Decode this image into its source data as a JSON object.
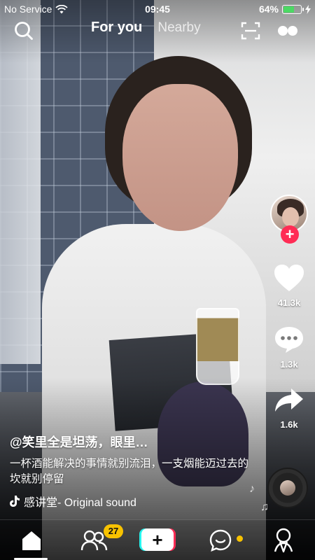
{
  "status_bar": {
    "carrier": "No Service",
    "time": "09:45",
    "battery_percent": "64%",
    "battery_level": 0.64
  },
  "top_nav": {
    "tabs": [
      {
        "label": "For you",
        "active": true
      },
      {
        "label": "Nearby",
        "active": false
      }
    ],
    "icons": [
      "search-icon",
      "scan-icon",
      "more-icon"
    ]
  },
  "side_rail": {
    "like_count": "41.3k",
    "comment_count": "1.3k",
    "share_count": "1.6k",
    "follow_symbol": "+"
  },
  "caption": {
    "username": "@笑里全是坦荡，眼里…",
    "description": "一杯酒能解决的事情就别流泪，一支烟能迈过去的坎就别停留",
    "music": "感讲堂- Original sound"
  },
  "bottom_nav": {
    "friends_badge": "27",
    "create_symbol": "+",
    "items": [
      "home-icon",
      "friends-icon",
      "create-button",
      "inbox-icon",
      "me-icon"
    ]
  },
  "colors": {
    "accent_red": "#fe2c55",
    "accent_cyan": "#25f4ee",
    "badge_yellow": "#f7c200",
    "battery_green": "#4cd964"
  }
}
